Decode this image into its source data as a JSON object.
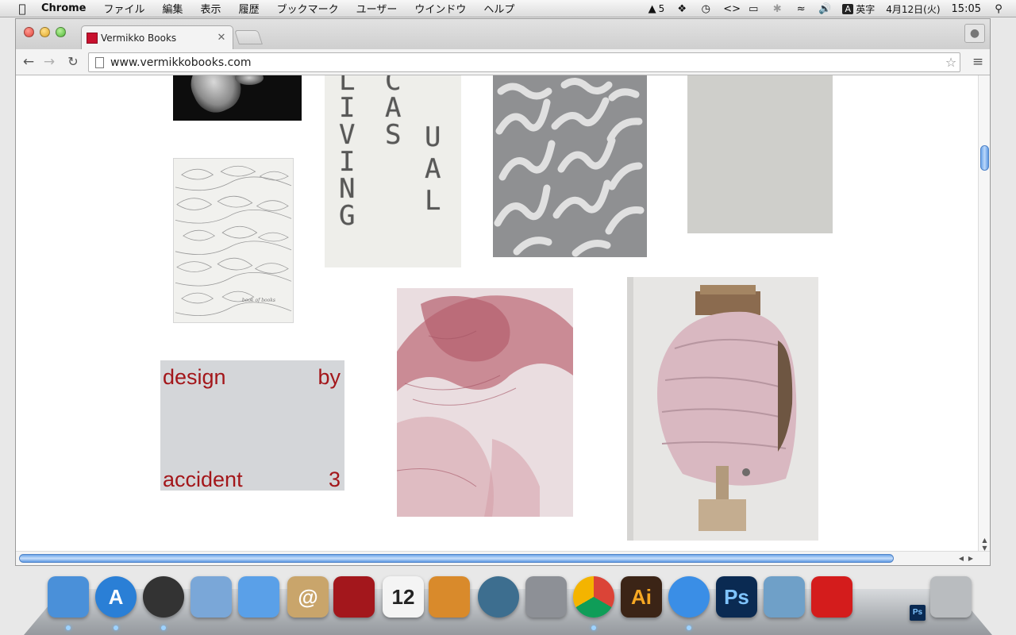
{
  "menubar": {
    "app_name": "Chrome",
    "menus": [
      "ファイル",
      "編集",
      "表示",
      "履歴",
      "ブックマーク",
      "ユーザー",
      "ウインドウ",
      "ヘルプ"
    ],
    "status": {
      "adobe_badge": "5",
      "input_method": "英字",
      "date": "4月12日(火)",
      "time": "15:05"
    }
  },
  "browser": {
    "tab_title": "Vermikko Books",
    "url": "www.vermikkobooks.com"
  },
  "books": {
    "living_casual_letters": {
      "col1": "LIVING",
      "col2": "CASUAL"
    },
    "design_by_accident": {
      "word1": "design",
      "word2": "by",
      "word3": "accident",
      "word4": "3"
    },
    "book_of_books_caption": "book of books"
  },
  "colors": {
    "design_text": "#a3161a",
    "scroll_accent": "#6da6ea"
  },
  "dock": {
    "items": [
      {
        "name": "finder-icon",
        "label": "",
        "color": "#4a90d9"
      },
      {
        "name": "app-store-icon",
        "label": "A",
        "color": "#2a7fd6"
      },
      {
        "name": "dashboard-icon",
        "label": "",
        "color": "#333333"
      },
      {
        "name": "mail-icon",
        "label": "",
        "color": "#7aa7d8"
      },
      {
        "name": "facetime-icon",
        "label": "",
        "color": "#5aa0e8"
      },
      {
        "name": "contacts-icon",
        "label": "@",
        "color": "#c9a56b"
      },
      {
        "name": "photo-booth-icon",
        "label": "",
        "color": "#a3171c"
      },
      {
        "name": "calendar-icon",
        "label": "12",
        "color": "#f4f4f4"
      },
      {
        "name": "iphoto-icon",
        "label": "",
        "color": "#d98a2b"
      },
      {
        "name": "time-machine-icon",
        "label": "",
        "color": "#3d6e8f"
      },
      {
        "name": "system-preferences-icon",
        "label": "",
        "color": "#8d9096"
      },
      {
        "name": "chrome-icon",
        "label": "",
        "color": "#db4437"
      },
      {
        "name": "illustrator-icon",
        "label": "Ai",
        "color": "#3b2416"
      },
      {
        "name": "safari-icon",
        "label": "",
        "color": "#3a8ee6"
      },
      {
        "name": "photoshop-icon",
        "label": "Ps",
        "color": "#0a2a52"
      },
      {
        "name": "preview-icon",
        "label": "",
        "color": "#6fa0c8"
      },
      {
        "name": "acrobat-icon",
        "label": "",
        "color": "#d41c1c"
      },
      {
        "name": "photoshop-doc-icon",
        "label": "Ps",
        "color": "#0a2a52"
      },
      {
        "name": "trash-icon",
        "label": "",
        "color": "#b9bcbf"
      }
    ]
  }
}
